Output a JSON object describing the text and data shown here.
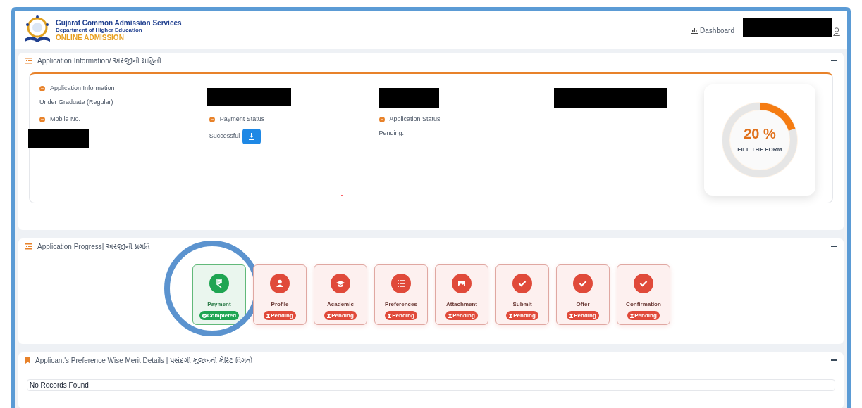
{
  "header": {
    "title": "Gujarat Common Admission Services",
    "subtitle": "Department of Higher Education",
    "product": "ONLINE ADMISSION",
    "nav": [
      {
        "label": "Dashboard"
      }
    ]
  },
  "application_info": {
    "title": "Application Information/ અરજીની માહિતી",
    "fields": [
      {
        "label": "Application Information",
        "value": "Under Graduate (Regular)"
      },
      {
        "label": "Mobile No.",
        "redacted": true
      },
      {
        "label": "Payment Status",
        "value": "Successful",
        "download": true
      },
      {
        "label": "Application Status",
        "value": "Pending."
      }
    ],
    "progress": {
      "level": 0.2,
      "reading": "20 %",
      "caption": "FILL THE FORM"
    }
  },
  "application_progress": {
    "title": "Application Progress| અરજીની પ્રગતિ",
    "steps": [
      {
        "name": "Payment",
        "status": "Completed",
        "completed": true,
        "kind": "rupee",
        "highlighted": true
      },
      {
        "name": "Profile",
        "status": "Pending",
        "completed": false,
        "kind": "user",
        "highlighted": false
      },
      {
        "name": "Academic",
        "status": "Pending",
        "completed": false,
        "kind": "cap",
        "highlighted": false
      },
      {
        "name": "Preferences",
        "status": "Pending",
        "completed": false,
        "kind": "list",
        "highlighted": false
      },
      {
        "name": "Attachment",
        "status": "Pending",
        "completed": false,
        "kind": "image",
        "highlighted": false
      },
      {
        "name": "Submit",
        "status": "Pending",
        "completed": false,
        "kind": "check",
        "highlighted": false
      },
      {
        "name": "Offer",
        "status": "Pending",
        "completed": false,
        "kind": "check",
        "highlighted": false
      },
      {
        "name": "Confirmation",
        "status": "Pending",
        "completed": false,
        "kind": "check",
        "highlighted": false
      }
    ]
  },
  "merit_details": {
    "title": "Applicant's Preference Wise Merit Details | પસંદગી મુજબની મેરિટ વિગતો",
    "message": "No Records Found"
  }
}
